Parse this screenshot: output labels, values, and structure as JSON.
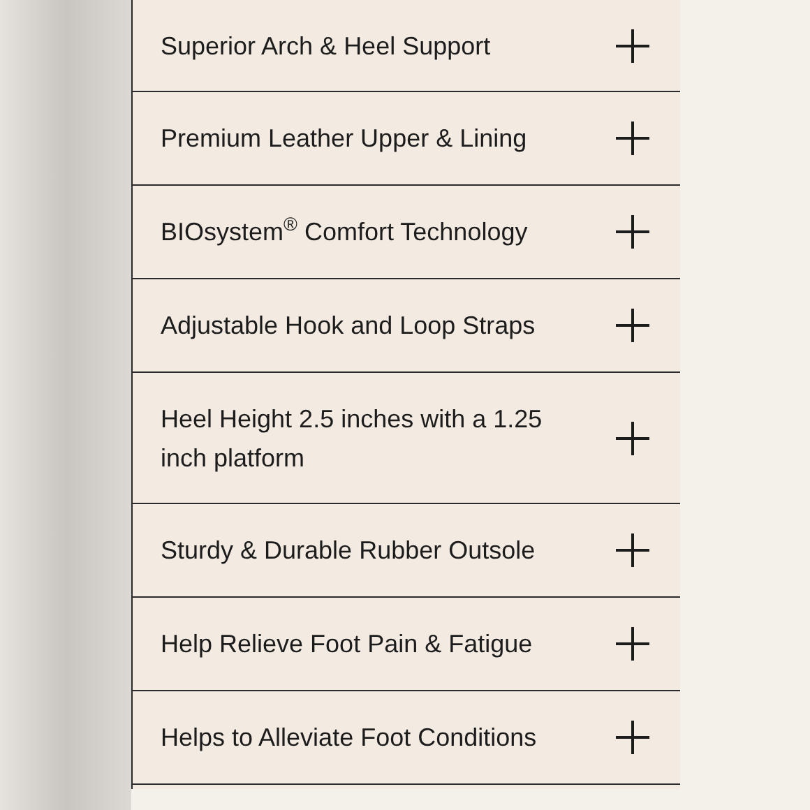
{
  "accordion": [
    {
      "label": "Superior Arch & Heel Support",
      "expanded": false
    },
    {
      "label": "Premium Leather Upper & Lining",
      "expanded": false
    },
    {
      "label": "BIOsystem$^{®}$ Comfort Technology",
      "expanded": false
    },
    {
      "label": "Adjustable Hook and Loop Straps",
      "expanded": false
    },
    {
      "label": "Heel Height 2.5 inches with a 1.25 inch platform",
      "expanded": false
    },
    {
      "label": "Sturdy & Durable Rubber Outsole",
      "expanded": false
    },
    {
      "label": "Help Relieve Foot Pain & Fatigue",
      "expanded": false
    },
    {
      "label": "Helps to Alleviate Foot Conditions",
      "expanded": false
    }
  ]
}
